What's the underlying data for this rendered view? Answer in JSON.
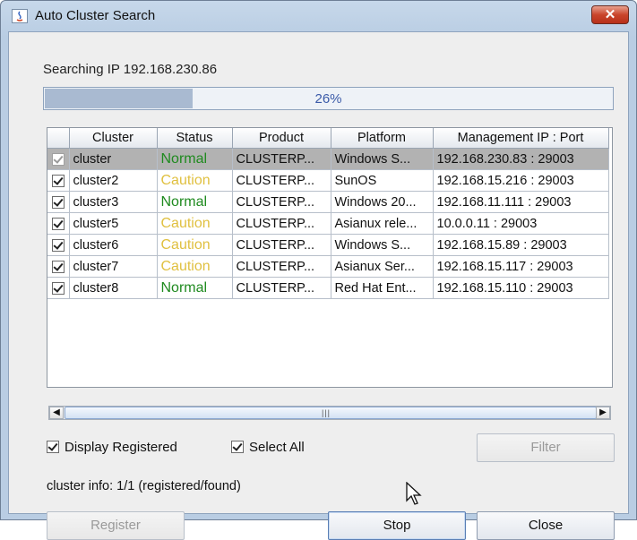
{
  "window": {
    "title": "Auto Cluster Search",
    "close_label": "✕"
  },
  "search": {
    "status_text": "Searching IP 192.168.230.86",
    "progress_percent": 26,
    "progress_label": "26%"
  },
  "table": {
    "columns": [
      "Cluster",
      "Status",
      "Product",
      "Platform",
      "Management IP : Port"
    ],
    "rows": [
      {
        "checked": true,
        "cluster": "cluster",
        "status": "Normal",
        "product": "CLUSTERP...",
        "platform": "Windows S...",
        "ip": "192.168.230.83 : 29003"
      },
      {
        "checked": true,
        "cluster": "cluster2",
        "status": "Caution",
        "product": "CLUSTERP...",
        "platform": "SunOS",
        "ip": "192.168.15.216 : 29003"
      },
      {
        "checked": true,
        "cluster": "cluster3",
        "status": "Normal",
        "product": "CLUSTERP...",
        "platform": "Windows 20...",
        "ip": "192.168.11.111 : 29003"
      },
      {
        "checked": true,
        "cluster": "cluster5",
        "status": "Caution",
        "product": "CLUSTERP...",
        "platform": "Asianux rele...",
        "ip": "10.0.0.11 : 29003"
      },
      {
        "checked": true,
        "cluster": "cluster6",
        "status": "Caution",
        "product": "CLUSTERP...",
        "platform": "Windows S...",
        "ip": "192.168.15.89 : 29003"
      },
      {
        "checked": true,
        "cluster": "cluster7",
        "status": "Caution",
        "product": "CLUSTERP...",
        "platform": "Asianux Ser...",
        "ip": "192.168.15.117 : 29003"
      },
      {
        "checked": true,
        "cluster": "cluster8",
        "status": "Normal",
        "product": "CLUSTERP...",
        "platform": "Red Hat Ent...",
        "ip": "192.168.15.110 : 29003"
      }
    ]
  },
  "options": {
    "display_registered_label": "Display Registered",
    "select_all_label": "Select All",
    "filter_label": "Filter"
  },
  "info": {
    "cluster_info": "cluster info: 1/1 (registered/found)"
  },
  "buttons": {
    "register": "Register",
    "stop": "Stop",
    "close": "Close"
  },
  "colors": {
    "normal": "#1f8a1f",
    "caution": "#e0c040",
    "progress_text": "#3a5aa8"
  }
}
